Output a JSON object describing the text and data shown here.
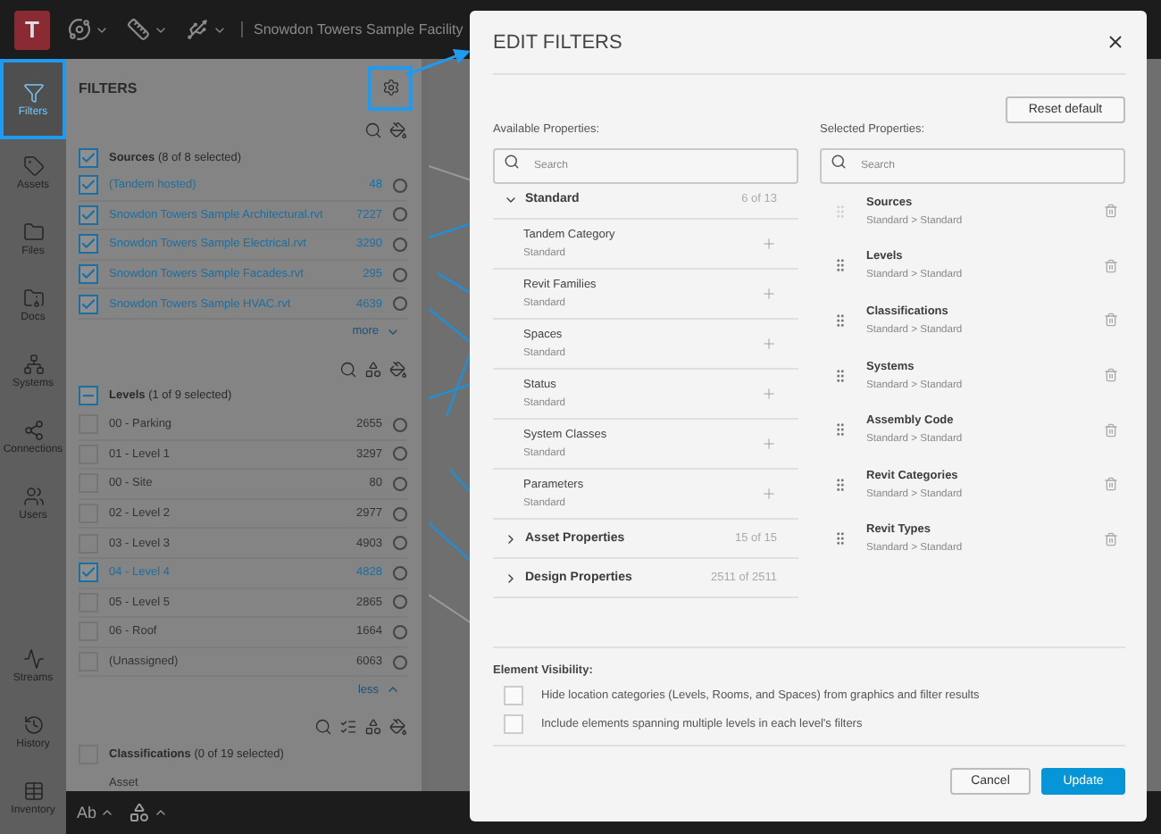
{
  "top_bar": {
    "logo": "T",
    "title": "Snowdon Towers Sample Facility"
  },
  "rail": [
    {
      "label": "Filters",
      "selected": true
    },
    {
      "label": "Assets",
      "selected": false
    },
    {
      "label": "Files",
      "selected": false
    },
    {
      "label": "Docs",
      "selected": false
    },
    {
      "label": "Systems",
      "selected": false
    },
    {
      "label": "Connections",
      "selected": false
    },
    {
      "label": "Users",
      "selected": false
    },
    {
      "label": "Streams",
      "selected": false
    },
    {
      "label": "History",
      "selected": false
    },
    {
      "label": "Inventory",
      "selected": false
    }
  ],
  "filters_panel": {
    "title": "FILTERS",
    "groups": [
      {
        "title": "Sources",
        "count": "(8 of 8 selected)",
        "checked": true,
        "toggle": "more",
        "items": [
          {
            "label": "(Tandem hosted)",
            "count": "48",
            "checked": true
          },
          {
            "label": "Snowdon Towers Sample Architectural.rvt",
            "count": "7227",
            "checked": true
          },
          {
            "label": "Snowdon Towers Sample Electrical.rvt",
            "count": "3290",
            "checked": true
          },
          {
            "label": "Snowdon Towers Sample Facades.rvt",
            "count": "295",
            "checked": true
          },
          {
            "label": "Snowdon Towers Sample HVAC.rvt",
            "count": "4639",
            "checked": true
          }
        ]
      },
      {
        "title": "Levels",
        "count": "(1 of 9 selected)",
        "partial": true,
        "toggle": "less",
        "items": [
          {
            "label": "00 - Parking",
            "count": "2655",
            "checked": false
          },
          {
            "label": "01 - Level 1",
            "count": "3297",
            "checked": false
          },
          {
            "label": "00 - Site",
            "count": "80",
            "checked": false
          },
          {
            "label": "02 - Level 2",
            "count": "2977",
            "checked": false
          },
          {
            "label": "03 - Level 3",
            "count": "4903",
            "checked": false
          },
          {
            "label": "04 - Level 4",
            "count": "4828",
            "checked": true
          },
          {
            "label": "05 - Level 5",
            "count": "2865",
            "checked": false
          },
          {
            "label": "06 - Roof",
            "count": "1664",
            "checked": false
          },
          {
            "label": "(Unassigned)",
            "count": "6063",
            "checked": false
          }
        ]
      },
      {
        "title": "Classifications",
        "count": "(0 of 19 selected)",
        "checked": false,
        "items": [
          {
            "label": "Asset"
          }
        ]
      }
    ]
  },
  "bottom_bar": {
    "text_tool": "Ab"
  },
  "dialog": {
    "title": "EDIT FILTERS",
    "reset": "Reset default",
    "available": {
      "label": "Available Properties:",
      "placeholder": "Search",
      "groups": [
        {
          "label": "Standard",
          "count": "6 of 13",
          "expanded": true,
          "items": [
            {
              "name": "Tandem Category",
              "source": "Standard"
            },
            {
              "name": "Revit Families",
              "source": "Standard"
            },
            {
              "name": "Spaces",
              "source": "Standard"
            },
            {
              "name": "Status",
              "source": "Standard"
            },
            {
              "name": "System Classes",
              "source": "Standard"
            },
            {
              "name": "Parameters",
              "source": "Standard"
            }
          ]
        },
        {
          "label": "Asset Properties",
          "count": "15 of 15",
          "expanded": false
        },
        {
          "label": "Design Properties",
          "count": "2511 of 2511",
          "expanded": false
        }
      ]
    },
    "selected": {
      "label": "Selected Properties:",
      "placeholder": "Search",
      "items": [
        {
          "name": "Sources",
          "path": "Standard > Standard",
          "locked": true
        },
        {
          "name": "Levels",
          "path": "Standard > Standard",
          "locked": false
        },
        {
          "name": "Classifications",
          "path": "Standard > Standard",
          "locked": false
        },
        {
          "name": "Systems",
          "path": "Standard > Standard",
          "locked": false
        },
        {
          "name": "Assembly Code",
          "path": "Standard > Standard",
          "locked": false
        },
        {
          "name": "Revit Categories",
          "path": "Standard > Standard",
          "locked": false
        },
        {
          "name": "Revit Types",
          "path": "Standard > Standard",
          "locked": false
        }
      ]
    },
    "visibility": {
      "title": "Element Visibility:",
      "options": [
        {
          "label": "Hide location categories (Levels, Rooms, and Spaces) from graphics and filter results",
          "checked": false
        },
        {
          "label": "Include elements spanning multiple levels in each level's filters",
          "checked": false
        }
      ]
    },
    "buttons": [
      {
        "label": "Cancel",
        "kind": "secondary"
      },
      {
        "label": "Update",
        "kind": "primary"
      }
    ]
  }
}
